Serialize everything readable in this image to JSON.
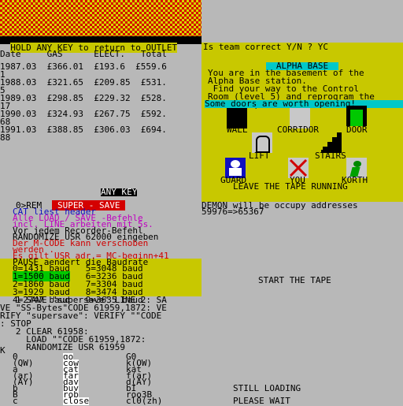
{
  "topLeft": {
    "checker": "checkered-banner",
    "banner": "HOLD ANY KEY to return to OUTLET",
    "headers": [
      "Date",
      "GAS",
      "ELECT.",
      "Total"
    ],
    "rows": [
      [
        "1987.03",
        "£366.01",
        "£193.6",
        "£559.6",
        "1"
      ],
      [
        "1988.03",
        "£321.65",
        "£209.85",
        "£531.",
        "5"
      ],
      [
        "1989.03",
        "£298.85",
        "£229.32",
        "£528.",
        "17"
      ],
      [
        "1990.03",
        "£324.93",
        "£267.75",
        "£592.",
        "68"
      ],
      [
        "1991.03",
        "£388.85",
        "£306.03",
        "£694.",
        "88"
      ]
    ]
  },
  "topRight": {
    "prompt": "Is team correct Y/N ? YC",
    "title": "ALPHA BASE",
    "intro": [
      "You are in the basement of the",
      "Alpha Base station.",
      " Find your way to the Control",
      "Room (level 5) and reprogram the",
      "Korth computer if you can."
    ],
    "hint": "Some doors are worth opening!",
    "legend": {
      "wall": "WALL",
      "corridor": "CORRIDOR",
      "door": "DOOR",
      "lift": "LIFT",
      "stairs": "STAIRS",
      "guard": "GUARD",
      "you": "YOU",
      "korth": "KORTH"
    },
    "footer": "LEAVE THE TAPE RUNNING"
  },
  "midLeft": {
    "anykey": "ANY KEY",
    "rem_prefix": "0>REM",
    "rem_title": " SUPER - SAVE ",
    "lines": [
      "CAT liest header",
      "Alle LOAD / SAVE -Befehle",
      "incl. LINE arbeiten mit 5s.",
      "Vor jedem Recorder-Befehl",
      "RANDOMIZE USR 62000 eingeben",
      "Der M-CODE kann verschoben",
      "werden .",
      "Es gilt USR adr.= MC-beginn+41",
      "PAUSE aendert die Baudrate"
    ],
    "bauds": [
      [
        "0=1431 baud",
        "5=3048 baud"
      ],
      [
        "1=1500 baud",
        "6=3236 baud"
      ],
      [
        "2=1860 baud",
        "7=3304 baud"
      ],
      [
        "3=1929 baud",
        "8=3474 baud"
      ],
      [
        "4=2747 baud",
        "9=3635 baud"
      ]
    ],
    "code": [
      "   1 SAVE \"supersave\" LINE 2: SA",
      "VE \"SS-Bytes\"CODE 61959,1872: VE",
      "RIFY \"supersave\": VERIFY \"\"CODE",
      ": STOP",
      "   2 CLEAR 61958:",
      "     LOAD \"\"CODE 61959,1872:",
      "     RANDOMIZE USR 61959"
    ]
  },
  "midRight": {
    "demon": "DEMON will be occupy addresses",
    "demon2": "59976=>65367",
    "start": "START THE TAPE"
  },
  "bottom": {
    "k": "K",
    "col1": [
      "0",
      "(QW)",
      "a",
      "(ar)",
      "(AY)",
      "b",
      "B",
      "c"
    ],
    "col2": [
      "go",
      "cow",
      "cat",
      "far",
      "day",
      "buy",
      "rob",
      "close"
    ],
    "col3": [
      "G0",
      "k(OW)",
      "kat",
      "f(ar)",
      "d(AY)",
      "bI",
      "roo3B",
      "cl0(zh)"
    ],
    "loading": "STILL LOADING",
    "wait": "PLEASE WAIT"
  }
}
